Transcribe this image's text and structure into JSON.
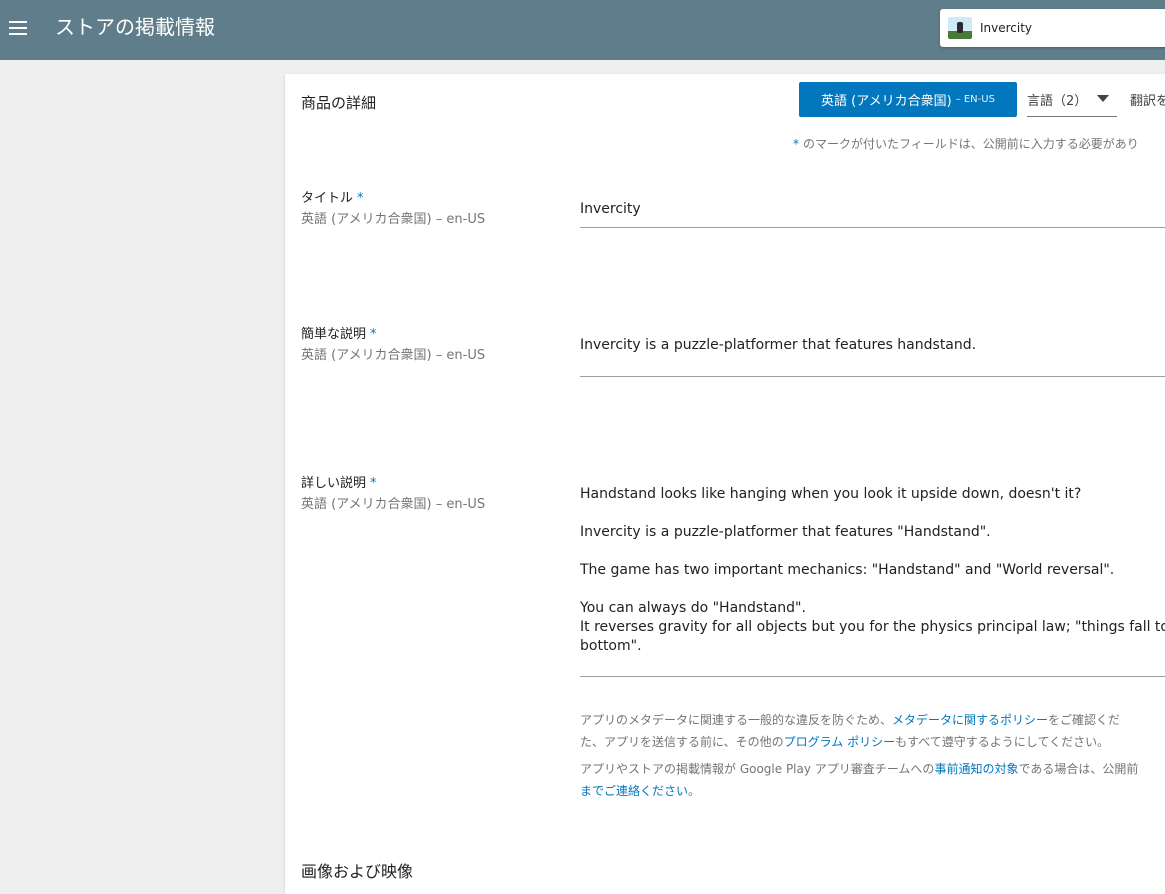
{
  "header": {
    "menu_icon": "hamburger-menu-icon",
    "title": "ストアの掲載情報",
    "app_name": "Invercity",
    "app_icon": "app-thumbnail-icon",
    "bar_color": "#607d8b"
  },
  "card": {
    "title": "商品の詳細",
    "language_button": {
      "main": "英語 (アメリカ合衆国)",
      "sub": "– EN-US"
    },
    "languages_select": "言語（2）",
    "translate_link": "翻訳を",
    "required_note": {
      "star": "*",
      "text": "のマークが付いたフィールドは、公開前に入力する必要があり"
    }
  },
  "fields": {
    "title": {
      "label": "タイトル",
      "star": "*",
      "locale": "英語 (アメリカ合衆国) – en-US",
      "value": "Invercity"
    },
    "short_description": {
      "label": "簡単な説明",
      "star": "*",
      "locale": "英語 (アメリカ合衆国) – en-US",
      "value": "Invercity is a puzzle-platformer that features handstand."
    },
    "full_description": {
      "label": "詳しい説明",
      "star": "*",
      "locale": "英語 (アメリカ合衆国) – en-US",
      "lines": [
        "Handstand looks like hanging when you look it upside down, doesn't it?",
        "Invercity is a puzzle-platformer that features \"Handstand\".",
        "The game has two important mechanics: \"Handstand\" and \"World reversal\".",
        "You can always do \"Handstand\".",
        "It reverses gravity for all objects but you for the physics principal law; \"things fall to",
        "bottom\"."
      ]
    }
  },
  "policy": {
    "p1_before": "アプリのメタデータに関連する一般的な違反を防ぐため、",
    "p1_link1": "メタデータに関するポリシー",
    "p1_after": "をご確認くだ",
    "p1_line2_before": "た、アプリを送信する前に、その他の",
    "p1_link2": "プログラム ポリシー",
    "p1_line2_after": "もすべて遵守するようにしてください。",
    "p2_before": "アプリやストアの掲載情報が Google Play アプリ審査チームへの",
    "p2_link1": "事前通知の対象",
    "p2_after": "である場合は、公開前",
    "p2_link2": "までご連絡ください",
    "p2_end": "。"
  },
  "images_section": {
    "title": "画像および映像"
  },
  "colors": {
    "accent": "#0277bd",
    "background": "#eeeeee"
  }
}
